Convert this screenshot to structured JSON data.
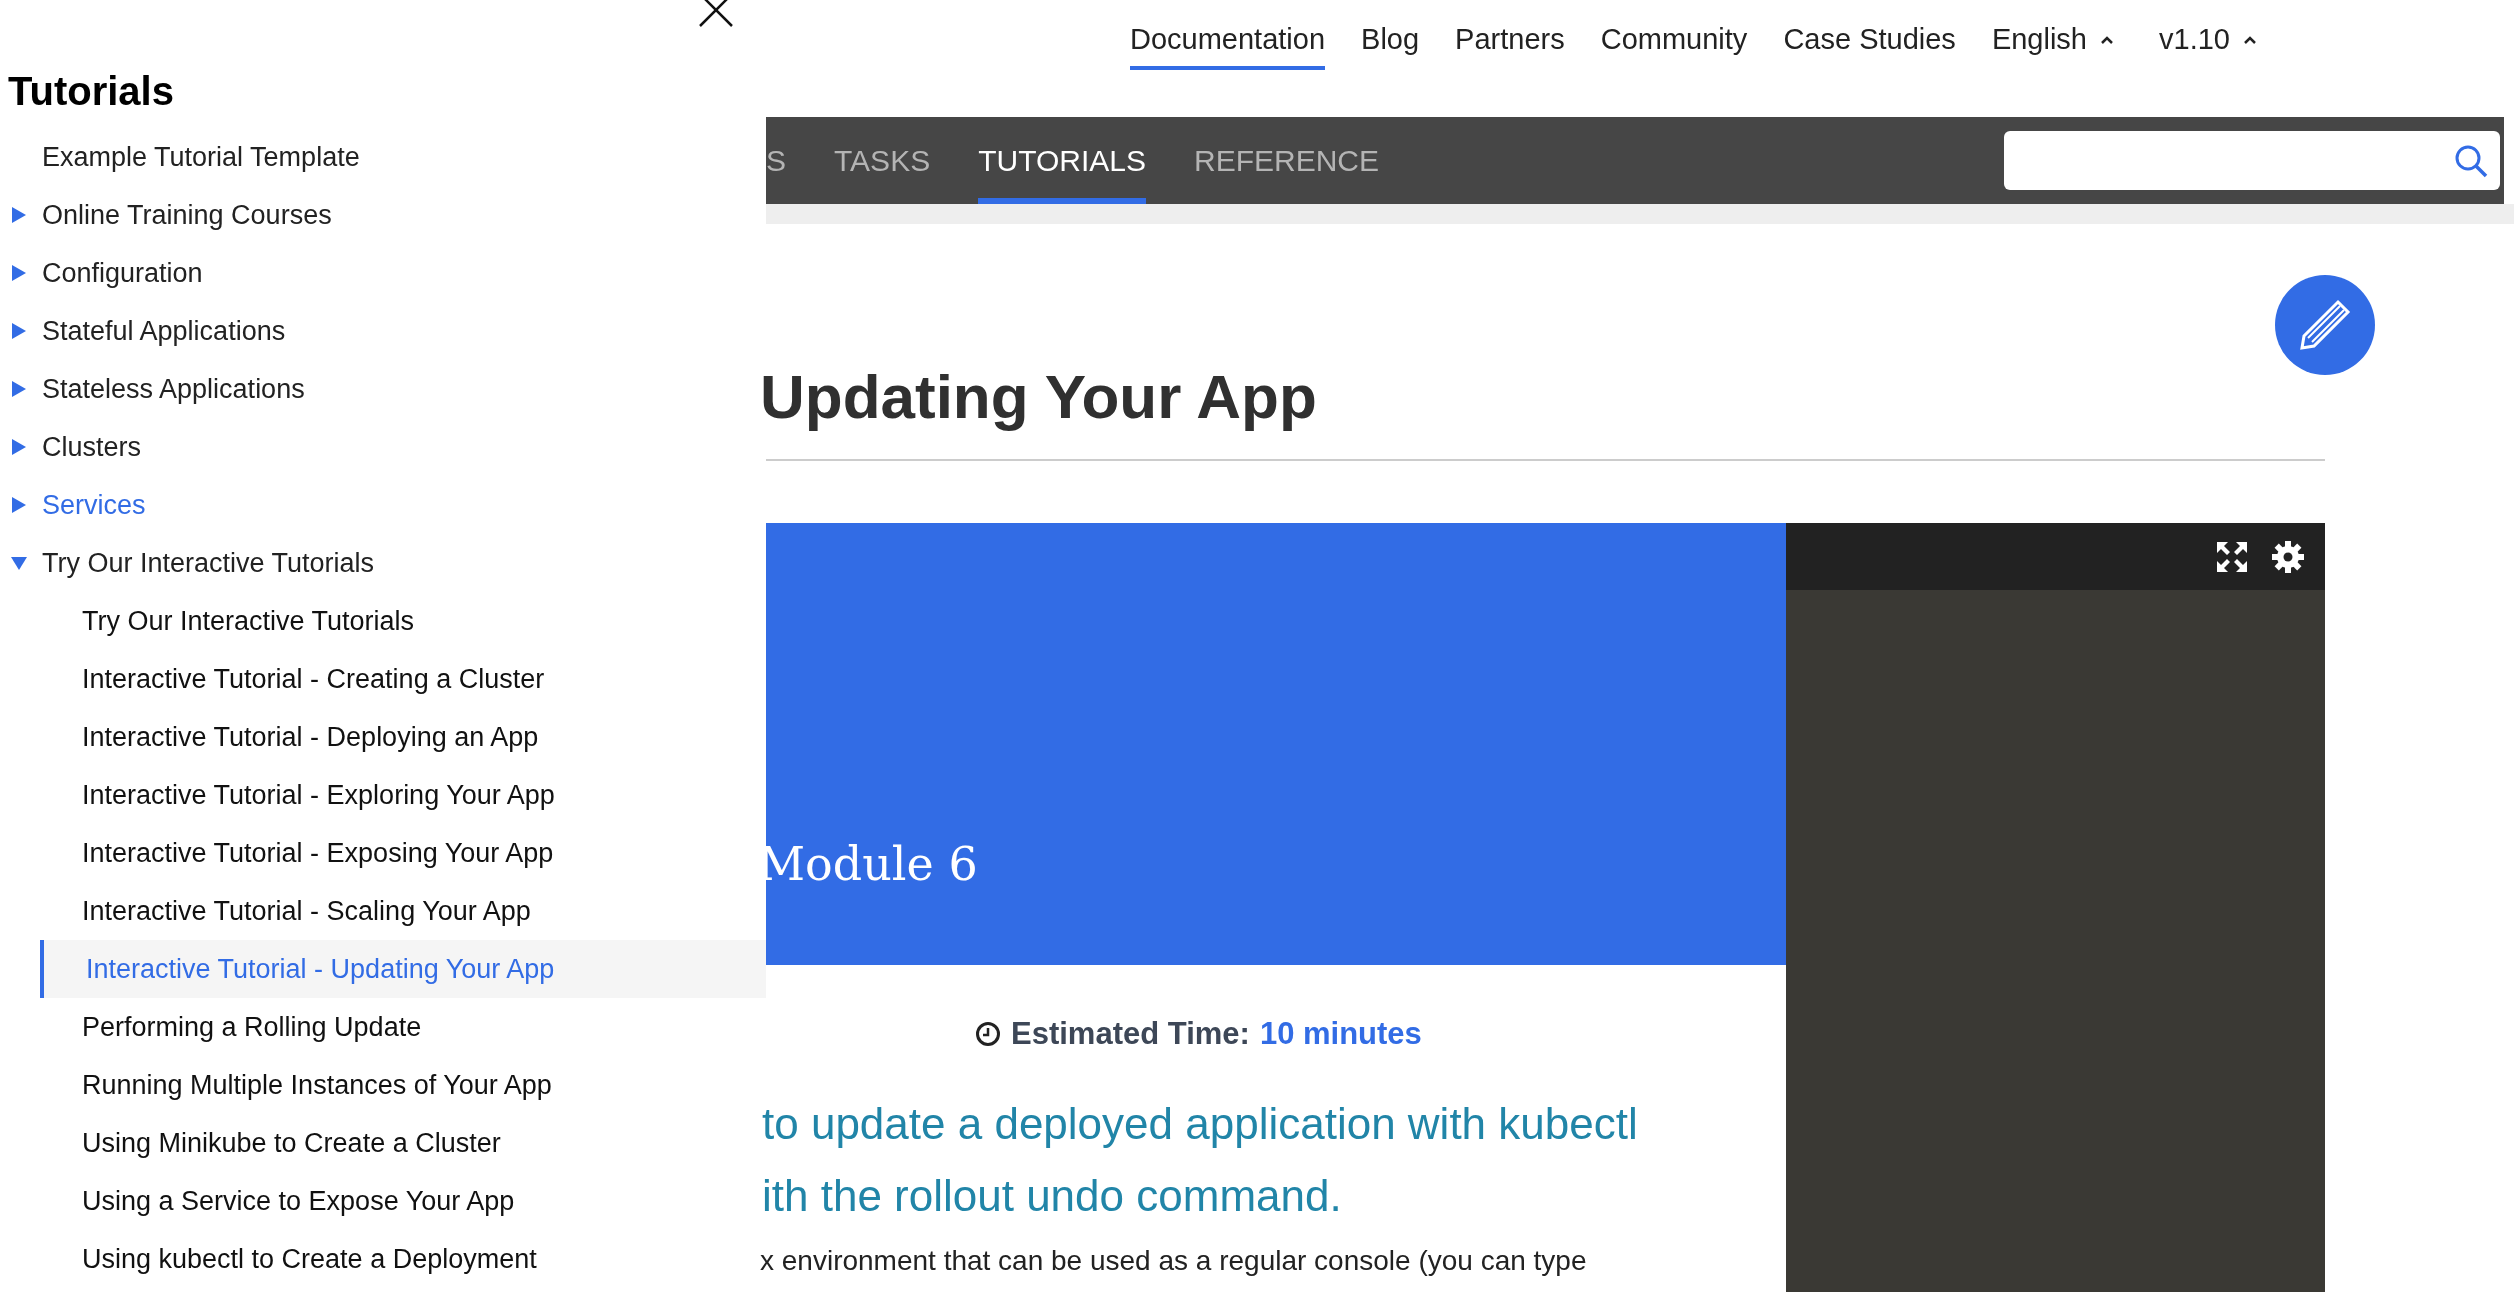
{
  "top_nav": {
    "links": [
      {
        "label": "Documentation",
        "selected": true
      },
      {
        "label": "Blog",
        "selected": false
      },
      {
        "label": "Partners",
        "selected": false
      },
      {
        "label": "Community",
        "selected": false
      },
      {
        "label": "Case Studies",
        "selected": false
      }
    ],
    "dropdowns": [
      {
        "label": "English",
        "expanded": true
      },
      {
        "label": "v1.10",
        "expanded": true
      }
    ]
  },
  "section_tabs": [
    {
      "label": "S",
      "selected": false
    },
    {
      "label": "TASKS",
      "selected": false
    },
    {
      "label": "TUTORIALS",
      "selected": true
    },
    {
      "label": "REFERENCE",
      "selected": false
    }
  ],
  "sidebar": {
    "title": "Tutorials",
    "items": [
      {
        "kind": "page",
        "label": "Example Tutorial Template",
        "hovered": false
      },
      {
        "kind": "section",
        "label": "Online Training Courses",
        "hovered": false,
        "expanded": false
      },
      {
        "kind": "section",
        "label": "Configuration",
        "hovered": false,
        "expanded": false
      },
      {
        "kind": "section",
        "label": "Stateful Applications",
        "hovered": false,
        "expanded": false
      },
      {
        "kind": "section",
        "label": "Stateless Applications",
        "hovered": false,
        "expanded": false
      },
      {
        "kind": "section",
        "label": "Clusters",
        "hovered": false,
        "expanded": false
      },
      {
        "kind": "section",
        "label": "Services",
        "hovered": true,
        "expanded": false
      },
      {
        "kind": "section",
        "label": "Try Our Interactive Tutorials",
        "hovered": false,
        "expanded": true,
        "children": [
          {
            "label": "Try Our Interactive Tutorials",
            "selected": false
          },
          {
            "label": "Interactive Tutorial - Creating a Cluster",
            "selected": false
          },
          {
            "label": "Interactive Tutorial - Deploying an App",
            "selected": false
          },
          {
            "label": "Interactive Tutorial - Exploring Your App",
            "selected": false
          },
          {
            "label": "Interactive Tutorial - Exposing Your App",
            "selected": false
          },
          {
            "label": "Interactive Tutorial - Scaling Your App",
            "selected": false
          },
          {
            "label": "Interactive Tutorial - Updating Your App",
            "selected": true
          },
          {
            "label": "Performing a Rolling Update",
            "selected": false
          },
          {
            "label": "Running Multiple Instances of Your App",
            "selected": false
          },
          {
            "label": "Using Minikube to Create a Cluster",
            "selected": false
          },
          {
            "label": "Using a Service to Expose Your App",
            "selected": false
          },
          {
            "label": "Using kubectl to Create a Deployment",
            "selected": false
          }
        ]
      }
    ]
  },
  "page_title": "Updating Your App",
  "banner": {
    "title": "Module 6"
  },
  "estimated_time": {
    "label": "Estimated Time:",
    "value": "10 minutes"
  },
  "objective_lines": [
    "to update a deployed application with kubectl",
    "ith the rollout undo command."
  ],
  "paragraph": "x environment that can be used as a regular console (you can type"
}
